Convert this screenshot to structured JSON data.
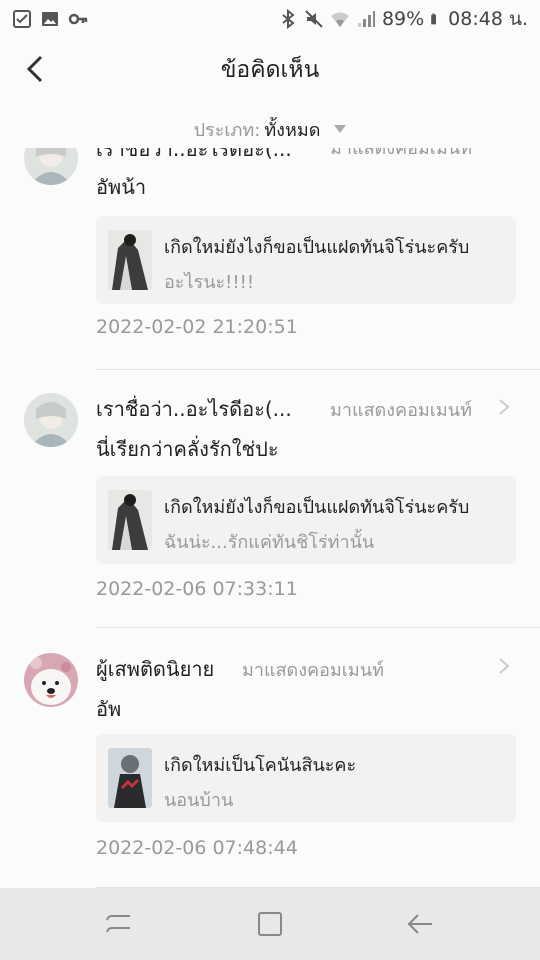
{
  "status_bar": {
    "icons_left": [
      "checkbox-icon",
      "image-icon",
      "key-icon"
    ],
    "icons_right": [
      "bluetooth-icon",
      "mute-icon",
      "wifi-icon",
      "signal-icon"
    ],
    "battery": "89%",
    "time": "08:48 น."
  },
  "header": {
    "title": "ข้อคิดเห็น",
    "back_icon": "chevron-left-icon"
  },
  "filter": {
    "label": "ประเภท:",
    "value": "ทั้งหมด"
  },
  "comments": [
    {
      "username": "เราชื่อว่า..อะไรดีอะ(...",
      "action": "มาแสดงคอมเมนท์",
      "text": "อัพน้า",
      "card_title": "เกิดใหม่ยังไงก็ขอเป็นแฝดทันจิโร่นะครับ",
      "card_subtitle": "อะไรนะ!!!!",
      "timestamp": "2022-02-02 21:20:51"
    },
    {
      "username": "เราชื่อว่า..อะไรดีอะ(...",
      "action": "มาแสดงคอมเมนท์",
      "text": "นี่เรียกว่าคลั่งรักใช่ปะ",
      "card_title": "เกิดใหม่ยังไงก็ขอเป็นแฝดทันจิโร่นะครับ",
      "card_subtitle": "ฉันน่ะ...รักแค่ทันชิโร่ท่านั้น",
      "timestamp": "2022-02-06 07:33:11"
    },
    {
      "username": "ผู้เสพติดนิยาย",
      "action": "มาแสดงคอมเมนท์",
      "text": "อัพ",
      "card_title": "เกิดใหม่เป็นโคนันสินะคะ",
      "card_subtitle": "นอนบ้าน",
      "timestamp": "2022-02-06 07:48:44"
    }
  ],
  "nav": {
    "buttons": [
      "recent-apps-icon",
      "home-icon",
      "back-icon"
    ]
  }
}
